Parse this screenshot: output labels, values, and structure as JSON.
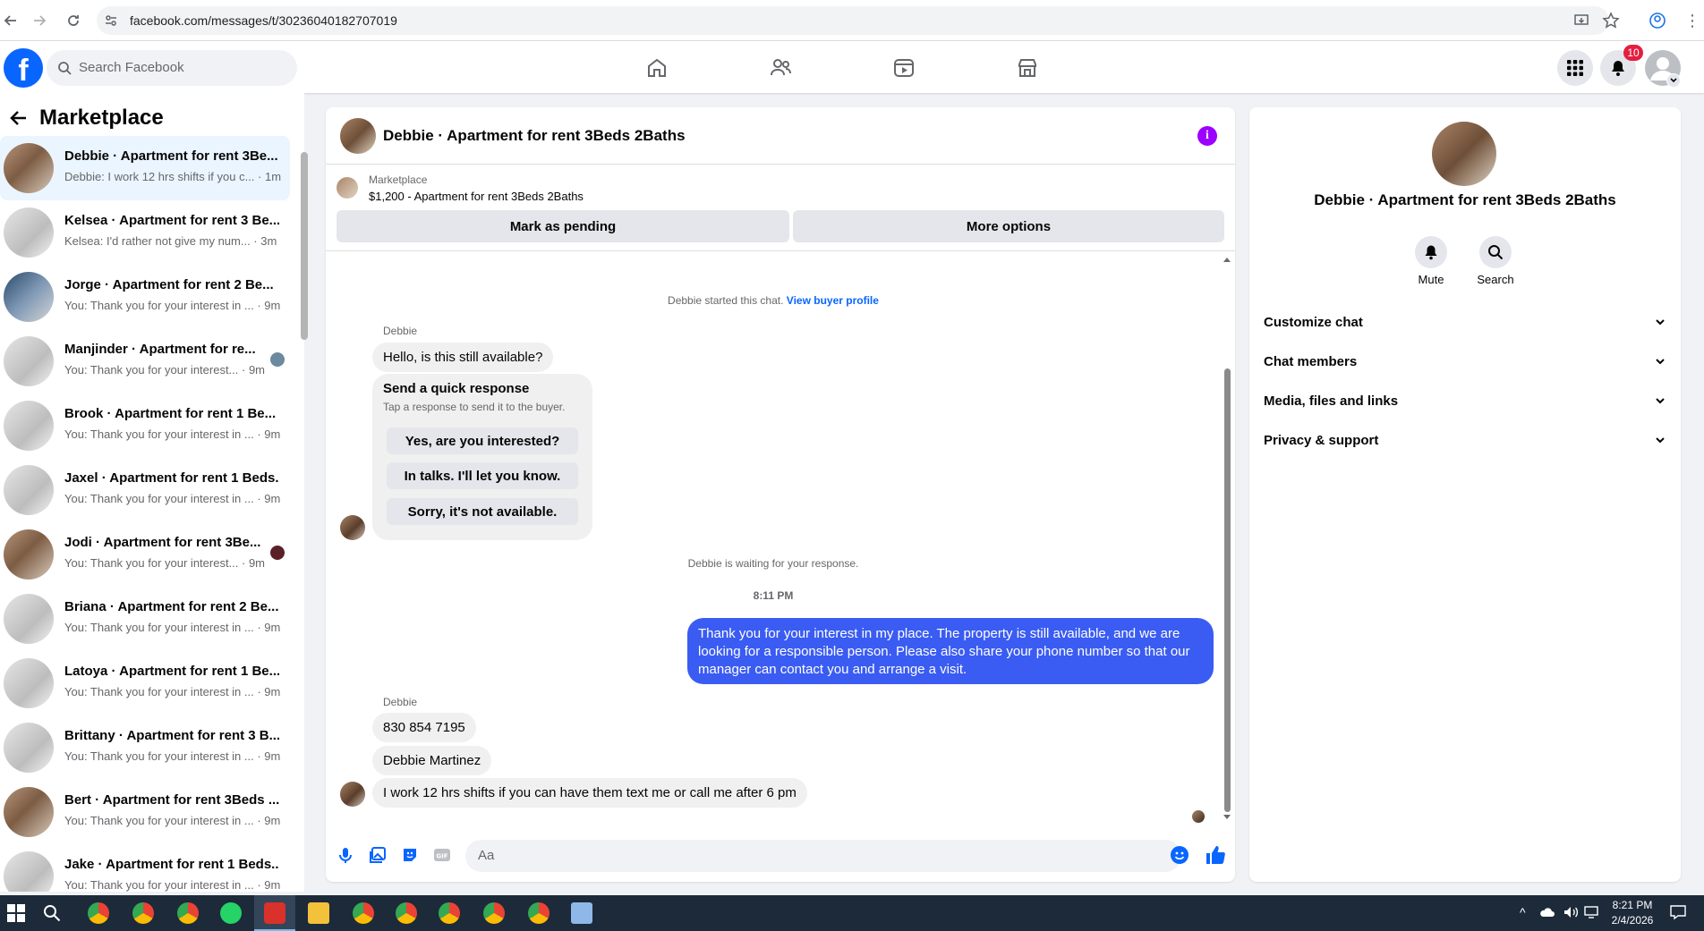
{
  "browser": {
    "url": "facebook.com/messages/t/30236040182707019"
  },
  "header": {
    "logo": "f",
    "search_placeholder": "Search Facebook",
    "notification_count": "10"
  },
  "sidebar": {
    "title": "Marketplace",
    "conversations": [
      {
        "name": "Debbie · Apartment for rent 3Be...",
        "preview": "Debbie: I work 12 hrs shifts if you c... · 1m"
      },
      {
        "name": "Kelsea · Apartment for rent 3 Be...",
        "preview": "Kelsea: I'd rather not give my num... · 3m"
      },
      {
        "name": "Jorge · Apartment for rent 2 Be...",
        "preview": "You: Thank you for your interest in ... · 9m"
      },
      {
        "name": "Manjinder · Apartment for re...",
        "preview": "You: Thank you for your interest... · 9m"
      },
      {
        "name": "Brook · Apartment for rent 1 Be...",
        "preview": "You: Thank you for your interest in ... · 9m"
      },
      {
        "name": "Jaxel · Apartment for rent 1 Beds...",
        "preview": "You: Thank you for your interest in ... · 9m"
      },
      {
        "name": "Jodi · Apartment for rent 3Be...",
        "preview": "You: Thank you for your interest... · 9m"
      },
      {
        "name": "Briana · Apartment for rent 2 Be...",
        "preview": "You: Thank you for your interest in ... · 9m"
      },
      {
        "name": "Latoya · Apartment for rent 1 Be...",
        "preview": "You: Thank you for your interest in ... · 9m"
      },
      {
        "name": "Brittany · Apartment for rent 3 B...",
        "preview": "You: Thank you for your interest in ... · 9m"
      },
      {
        "name": "Bert · Apartment for rent 3Beds ...",
        "preview": "You: Thank you for your interest in ... · 9m"
      },
      {
        "name": "Jake · Apartment for rent 1 Beds...",
        "preview": "You: Thank you for your interest in ... · 9m"
      }
    ]
  },
  "chat": {
    "title": "Debbie · Apartment for rent 3Beds 2Baths",
    "listing_source": "Marketplace",
    "listing_title": "$1,200 - Apartment for rent 3Beds 2Baths",
    "mark_pending": "Mark as pending",
    "more_options": "More options",
    "started_text": "Debbie started this chat.",
    "view_profile": "View buyer profile",
    "sender_name": "Debbie",
    "msg1": "Hello, is this still available?",
    "quick_title": "Send a quick response",
    "quick_sub": "Tap a response to send it to the buyer.",
    "quick_options": [
      "Yes, are you interested?",
      "In talks. I'll let you know.",
      "Sorry, it's not available."
    ],
    "waiting_text": "Debbie is waiting for your response.",
    "time": "8:11 PM",
    "outgoing": "Thank you for your interest in my place. The property is still available, and we are looking for a responsible person. Please also share your phone number so that our manager can contact you and arrange a visit.",
    "sender_name2": "Debbie",
    "msg_phone": "830 854 7195",
    "msg_name": "Debbie Martinez",
    "msg_shift": "I work 12 hrs shifts if you can have them text me or call me after 6 pm",
    "composer_placeholder": "Aa"
  },
  "right_panel": {
    "name": "Debbie · Apartment for rent 3Beds 2Baths",
    "mute": "Mute",
    "search": "Search",
    "sections": [
      "Customize chat",
      "Chat members",
      "Media, files and links",
      "Privacy & support"
    ]
  },
  "taskbar": {
    "time": "8:21 PM",
    "date": "2/4/2026"
  },
  "colors": {
    "brand": "#0866ff",
    "outgoing_bubble": "#3a5cf2",
    "info": "#9c00ff"
  }
}
